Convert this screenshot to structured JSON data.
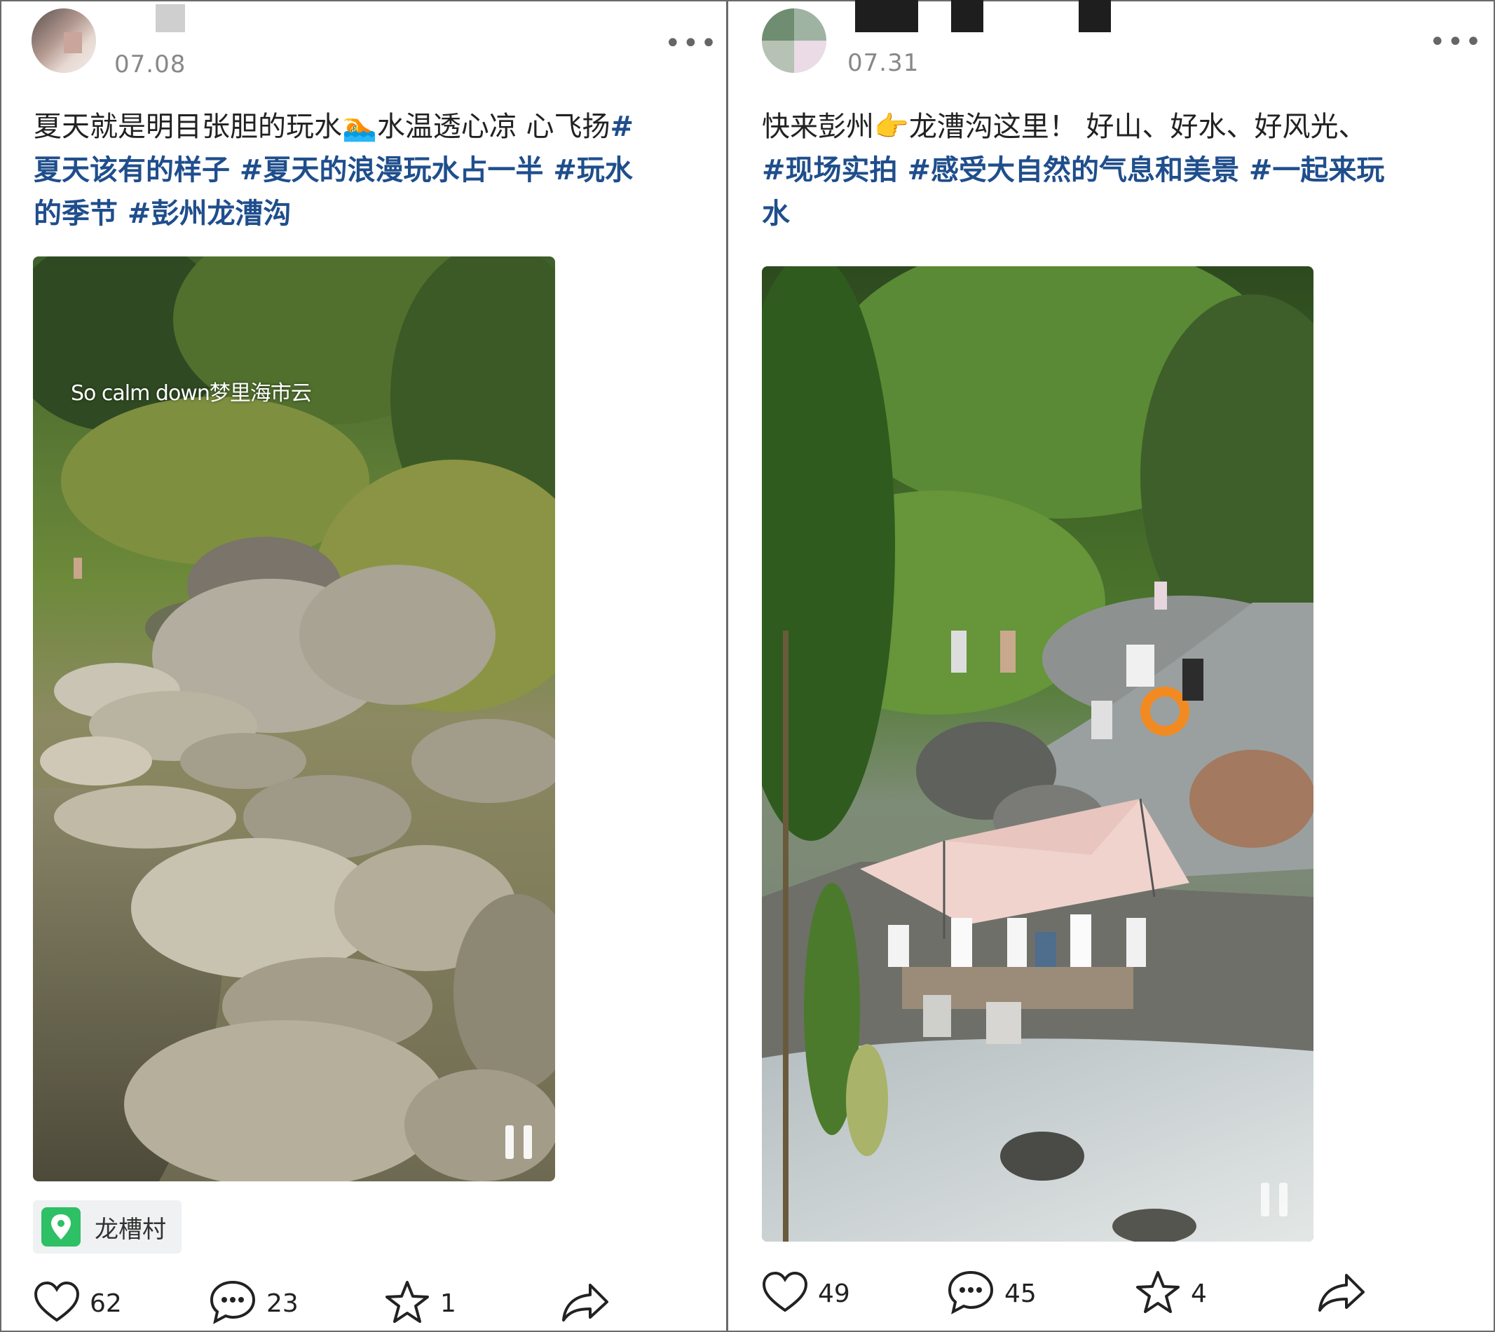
{
  "posts": [
    {
      "date": "07.08",
      "text_plain": "夏天就是明目张胆的玩水",
      "emoji": "🏊",
      "text_plain2": "水温透心凉 心飞扬",
      "tags_line1": "#",
      "line2": "夏天该有的样子 #夏天的浪漫玩水占一半 #玩水",
      "line3": "的季节 #彭州龙漕沟",
      "video_caption": "So calm down梦里海市云",
      "location": "龙槽村",
      "likes": "62",
      "comments": "23",
      "favorites": "1",
      "icons": [
        "heart-icon",
        "comment-icon",
        "star-icon",
        "share-icon",
        "location-pin-icon",
        "pause-icon",
        "more-icon"
      ]
    },
    {
      "date": "07.31",
      "text_plain": "快来彭州",
      "emoji": "👉",
      "text_plain2": "龙漕沟这里！ 好山、好水、好风光、",
      "line2": "#现场实拍 #感受大自然的气息和美景 #一起来玩",
      "line3": "水",
      "likes": "49",
      "comments": "45",
      "favorites": "4",
      "icons": [
        "heart-icon",
        "comment-icon",
        "star-icon",
        "share-icon",
        "pause-icon",
        "more-icon"
      ]
    }
  ],
  "colors": {
    "hashtag": "#1f4e8c",
    "location_pin": "#2dc064",
    "border": "#6a6a6a"
  }
}
